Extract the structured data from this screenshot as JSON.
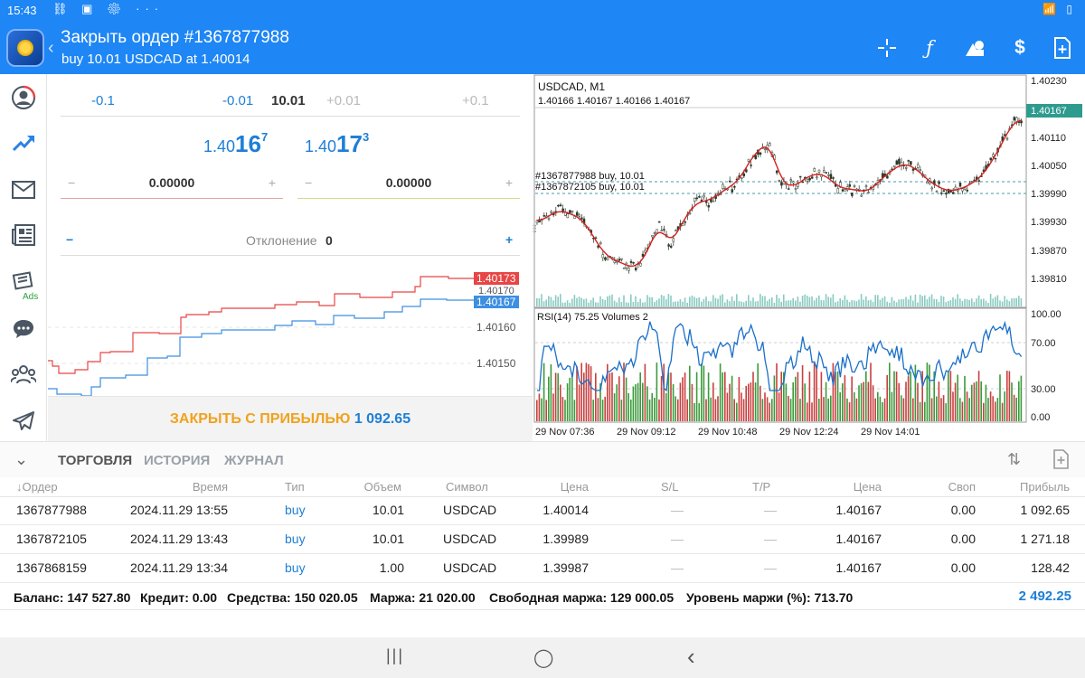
{
  "status_bar": {
    "time": "15:43",
    "left_icons": "⛓ ▣ ⚙ ···",
    "right_icons": "📶 ▯"
  },
  "header": {
    "title": "Закрыть ордер #1367877988",
    "subtitle": "buy 10.01 USDCAD at 1.40014",
    "icons": [
      "crosshair-icon",
      "function-icon",
      "objects-icon",
      "dollar-sign-icon",
      "new-order-icon"
    ]
  },
  "sidebar": {
    "items": [
      {
        "name": "account",
        "icon": "◉"
      },
      {
        "name": "trade",
        "icon": "⤴"
      },
      {
        "name": "mail",
        "icon": "✉"
      },
      {
        "name": "news",
        "icon": "▤"
      },
      {
        "name": "ads",
        "icon": "⛭",
        "label": "Ads"
      },
      {
        "name": "chat",
        "icon": "💬"
      },
      {
        "name": "community",
        "icon": "👥"
      },
      {
        "name": "telegram",
        "icon": "➢"
      }
    ]
  },
  "order_panel": {
    "volume": {
      "m01": "-0.1",
      "m001": "-0.01",
      "current": "10.01",
      "p001": "+0.01",
      "p01": "+0.1"
    },
    "bid": {
      "prefix": "1.40",
      "big": "16",
      "sup": "7"
    },
    "ask": {
      "prefix": "1.40",
      "big": "17",
      "sup": "3"
    },
    "stop_loss": {
      "value": "0.00000",
      "minus": "−",
      "plus": "+"
    },
    "take_profit": {
      "value": "0.00000",
      "minus": "−",
      "plus": "+"
    },
    "deviation": {
      "label": "Отклонение",
      "value": "0",
      "minus": "−",
      "plus": "+"
    },
    "tick_chart": {
      "ask_tag": "1.40173",
      "bid_tag": "1.40167",
      "hidden_tag": "1.40170",
      "levels": [
        "1.40160",
        "1.40150"
      ],
      "ask_color": "#e84545",
      "bid_color": "#3d8fe0"
    },
    "close_button": {
      "label": "ЗАКРЫТЬ С ПРИБЫЛЬЮ",
      "value": "1 092.65"
    }
  },
  "main_chart": {
    "symbol_tf": "USDCAD, M1",
    "ohlc": "1.40166 1.40167 1.40166 1.40167",
    "order_lines": [
      "#1367877988 buy, 10.01",
      "#1367872105 buy, 10.01"
    ],
    "price_scale": [
      "1.40230",
      "1.40110",
      "1.40050",
      "1.39990",
      "1.39930",
      "1.39870",
      "1.39810"
    ],
    "current_price": "1.40167",
    "indicator_label": "RSI(14) 75.25 Volumes 2",
    "rsi_scale": [
      "100.00",
      "70.00",
      "30.00",
      "0.00"
    ],
    "time_labels": [
      "29 Nov 07:36",
      "29 Nov 09:12",
      "29 Nov 10:48",
      "29 Nov 12:24",
      "29 Nov 14:01"
    ],
    "ma_color": "#d42020",
    "rsi_color": "#1a6fc9"
  },
  "tabs": {
    "items": [
      "ТОРГОВЛЯ",
      "ИСТОРИЯ",
      "ЖУРНАЛ"
    ],
    "active": 0
  },
  "table": {
    "headers": [
      "↓Ордер",
      "Время",
      "Тип",
      "Объем",
      "Символ",
      "Цена",
      "S/L",
      "T/P",
      "Цена",
      "Своп",
      "Прибыль"
    ],
    "rows": [
      [
        "1367877988",
        "2024.11.29 13:55",
        "buy",
        "10.01",
        "USDCAD",
        "1.40014",
        "—",
        "—",
        "1.40167",
        "0.00",
        "1 092.65"
      ],
      [
        "1367872105",
        "2024.11.29 13:43",
        "buy",
        "10.01",
        "USDCAD",
        "1.39989",
        "—",
        "—",
        "1.40167",
        "0.00",
        "1 271.18"
      ],
      [
        "1367868159",
        "2024.11.29 13:34",
        "buy",
        "1.00",
        "USDCAD",
        "1.39987",
        "—",
        "—",
        "1.40167",
        "0.00",
        "128.42"
      ]
    ]
  },
  "summary": {
    "balance_label": "Баланс:",
    "balance": "147 527.80",
    "credit_label": "Кредит:",
    "credit": "0.00",
    "equity_label": "Средства:",
    "equity": "150 020.05",
    "margin_label": "Маржа:",
    "margin": "21 020.00",
    "free_margin_label": "Свободная маржа:",
    "free_margin": "129 000.05",
    "margin_level_label": "Уровень маржи (%):",
    "margin_level": "713.70",
    "total_profit": "2 492.25"
  },
  "navbar": {
    "recent": "|||",
    "home": "◯",
    "back": "‹"
  }
}
